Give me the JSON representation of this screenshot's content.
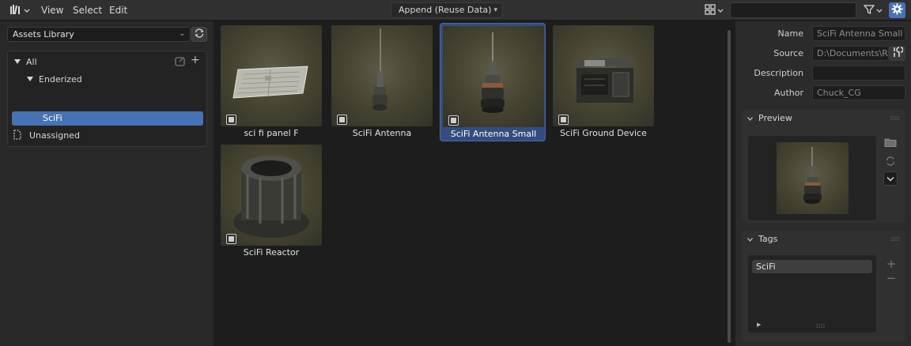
{
  "header": {
    "menus": [
      "View",
      "Select",
      "Edit"
    ],
    "import_method": "Append (Reuse Data)",
    "search": {
      "value": "",
      "placeholder": ""
    },
    "accent": "#4772b3"
  },
  "library": {
    "selected": "Assets Library"
  },
  "catalogs": {
    "all": "All",
    "group": "Enderized",
    "selected": "SciFi",
    "unassigned": "Unassigned"
  },
  "assets": [
    {
      "name": "sci fi panel F",
      "selected": false,
      "icon": "panel-thumbnail"
    },
    {
      "name": "SciFi Antenna",
      "selected": false,
      "icon": "antenna-thumbnail"
    },
    {
      "name": "SciFi Antenna Small",
      "selected": true,
      "icon": "antenna-small-thumbnail"
    },
    {
      "name": "SciFi Ground Device",
      "selected": false,
      "icon": "ground-device-thumbnail"
    },
    {
      "name": "SciFi Reactor",
      "selected": false,
      "icon": "reactor-thumbnail"
    }
  ],
  "properties": {
    "name_label": "Name",
    "name_value": "SciFi Antenna Small",
    "source_label": "Source",
    "source_value": "D:\\Documents\\R...",
    "description_label": "Description",
    "description_value": "",
    "author_label": "Author",
    "author_value": "Chuck_CG"
  },
  "preview": {
    "title": "Preview"
  },
  "tags": {
    "title": "Tags",
    "items": [
      "SciFi"
    ]
  }
}
